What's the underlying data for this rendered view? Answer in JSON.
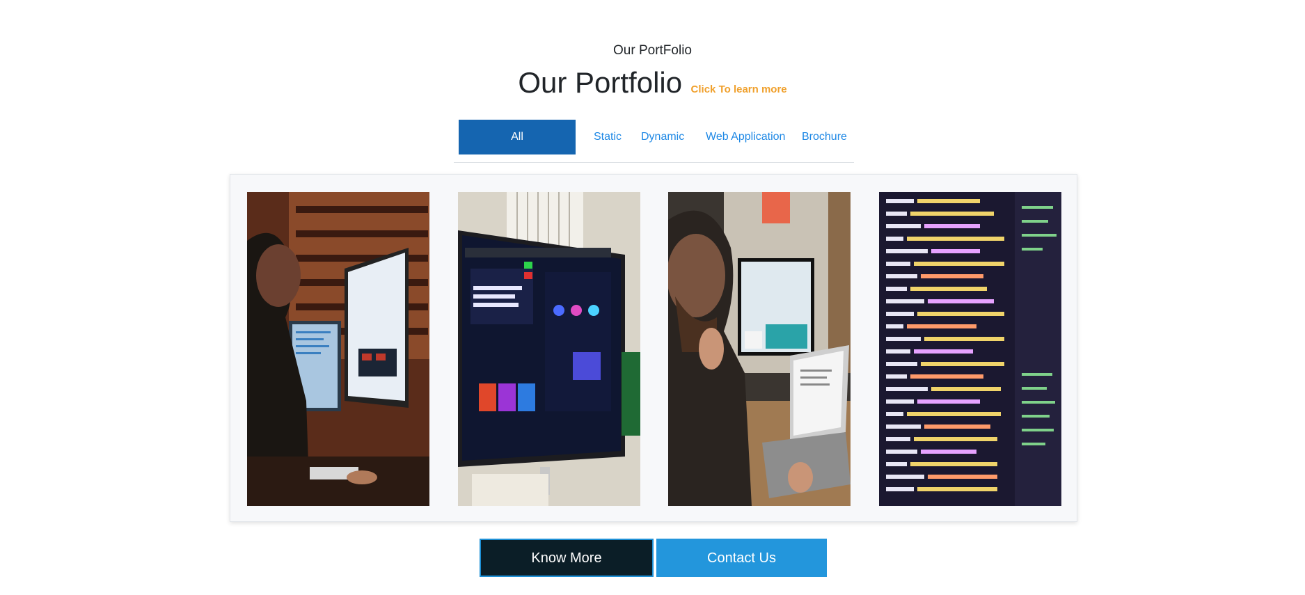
{
  "header": {
    "eyebrow": "Our PortFolio",
    "title": "Our Portfolio",
    "learn_more": "Click To learn more"
  },
  "tabs": [
    {
      "label": "All",
      "active": true
    },
    {
      "label": "Static",
      "active": false
    },
    {
      "label": "Dynamic",
      "active": false
    },
    {
      "label": "Web Application",
      "active": false
    },
    {
      "label": "Brochure",
      "active": false
    }
  ],
  "portfolio": {
    "items": [
      {
        "image": "developer-at-imac-photo"
      },
      {
        "image": "design-monitor-photo"
      },
      {
        "image": "man-at-laptop-photo"
      },
      {
        "image": "code-screen-photo"
      }
    ]
  },
  "actions": {
    "know_more": "Know More",
    "contact_us": "Contact Us"
  },
  "colors": {
    "accent": "#1565b0",
    "link": "#1e88e5",
    "learn_more": "#f0a02c",
    "dark_button": "#0b1e27",
    "contact_button": "#2396dc"
  }
}
